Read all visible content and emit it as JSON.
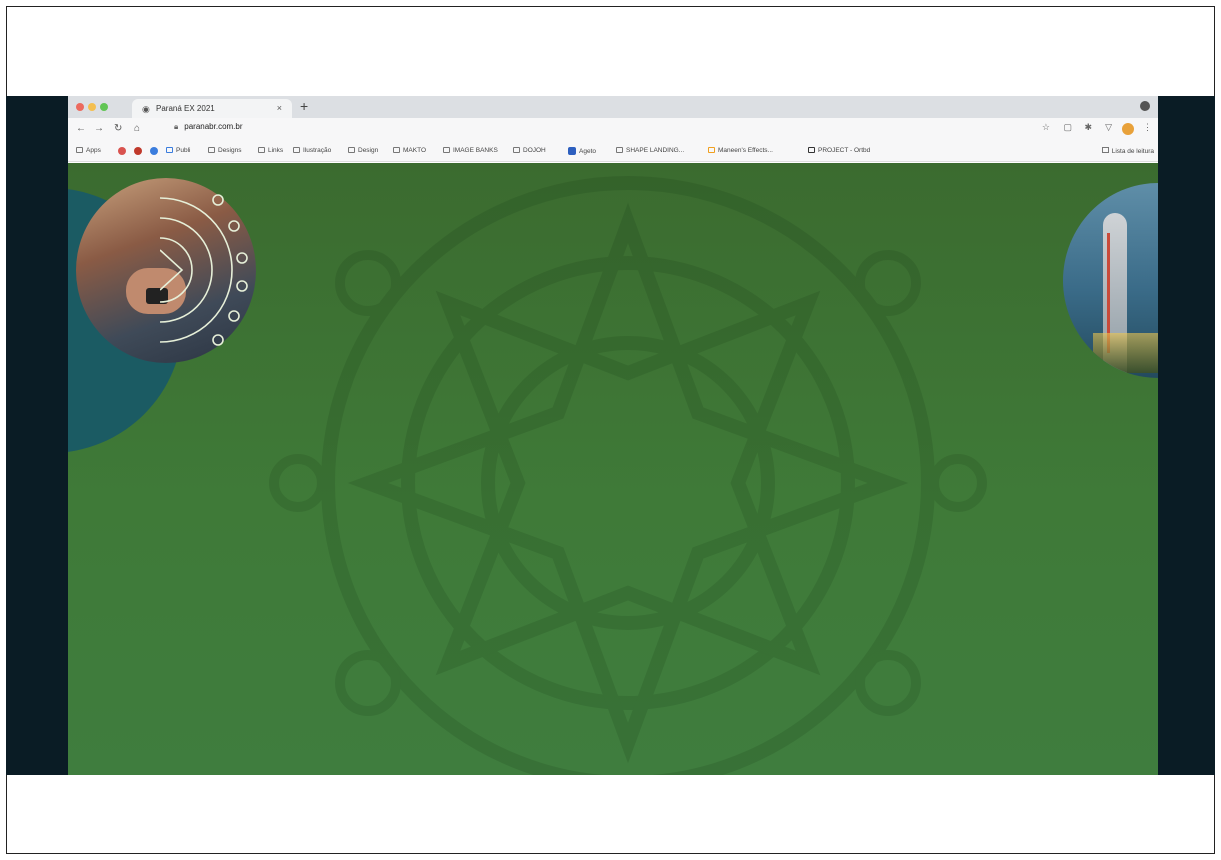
{
  "browser": {
    "tab_title": "Paraná EX 2021",
    "tab_close": "×",
    "new_tab": "+",
    "url": "paranabr.com.br",
    "reading_list": "Lista de leitura"
  },
  "bookmarks": [
    {
      "label": "Apps"
    },
    {
      "label": "Publi"
    },
    {
      "label": "Designs"
    },
    {
      "label": "Links"
    },
    {
      "label": "Ilustração"
    },
    {
      "label": "Design"
    },
    {
      "label": "MAKTO"
    },
    {
      "label": "IMAGE BANKS"
    },
    {
      "label": "DOJOH"
    },
    {
      "label": "Ageto"
    },
    {
      "label": "SHAPE LANDING..."
    },
    {
      "label": "Maneen's Effects..."
    },
    {
      "label": "PROJECT - Ortbd"
    }
  ],
  "colors": {
    "page_green": "#3f7a38",
    "left_teal": "#1b5b63",
    "frame_dark": "#0a1c25"
  }
}
